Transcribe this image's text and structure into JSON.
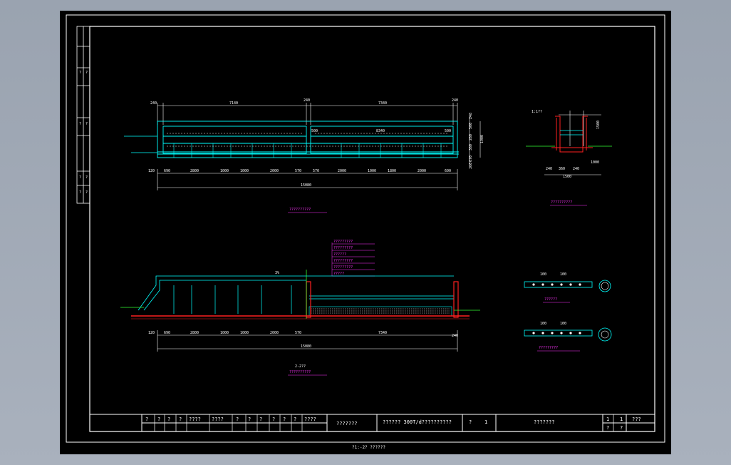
{
  "colors": {
    "background": "#000000",
    "frame": "#ffffff",
    "cyan": "#00ffff",
    "magenta": "#ff33ff",
    "red": "#ff2020",
    "green": "#33ff33",
    "yellow": "#ffff33"
  },
  "plan_view": {
    "top_dims": [
      "240",
      "7140",
      "240",
      "7340",
      "240"
    ],
    "inner_dims": [
      "500",
      "8340",
      "500"
    ],
    "right_dims": [
      "248",
      "500",
      "260",
      "360",
      "1900",
      "670",
      "300"
    ],
    "bottom_dims": [
      "120",
      "690",
      "2800",
      "1000",
      "1000",
      "2000",
      "570",
      "570",
      "2000",
      "1000",
      "1800",
      "2000",
      "690"
    ],
    "total": "15080",
    "title": "??????????"
  },
  "section_1_1": {
    "labels": [
      "1:1??",
      "1000",
      "1500"
    ],
    "dims": [
      "240",
      "360",
      "240",
      "1500"
    ],
    "title": "??????????"
  },
  "elevation": {
    "legend": [
      "?????????",
      "?????????",
      "??????",
      "?????????",
      "?????????",
      "?????"
    ],
    "bottom_dims": [
      "120",
      "690",
      "2800",
      "1000",
      "1000",
      "2000",
      "570",
      "7340",
      "240"
    ],
    "total": "15080",
    "slope": "3%",
    "caption": "2-2??",
    "title": "??????????"
  },
  "details": {
    "pipe_a_dims": [
      "100",
      "100"
    ],
    "pipe_a_title": "??????",
    "pipe_b_dims": [
      "100",
      "100"
    ],
    "pipe_b_title": "?????????"
  },
  "title_block": {
    "cells": [
      "?",
      "?",
      "?",
      "?",
      "????",
      "????",
      "?",
      "?",
      "?",
      "?",
      "?",
      "?",
      "????"
    ],
    "designer": "???????",
    "project": "??????  300T/d??????????",
    "scale": "?",
    "sheet_no": "1",
    "drawing_name": "???????",
    "right_top": [
      "1",
      "1",
      "???"
    ],
    "right_bottom": [
      "?",
      "?"
    ]
  },
  "sheet_caption": "?1:-2? ??????",
  "side_strip": [
    "?",
    "?",
    "?",
    "?",
    "?",
    "?",
    "?",
    "?"
  ]
}
